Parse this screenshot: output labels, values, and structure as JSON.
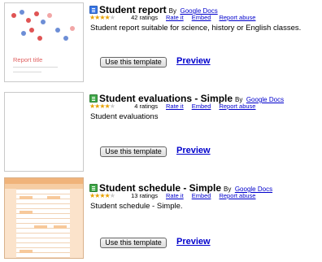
{
  "templates": [
    {
      "icon": "docs-icon",
      "title": "Student report",
      "by_label": "By",
      "author": "Google Docs",
      "rating_stars": 4,
      "ratings_label": "42 ratings",
      "rate_label": "Rate it",
      "embed_label": "Embed",
      "report_label": "Report abuse",
      "description": "Student report suitable for science, history or English classes.",
      "use_label": "Use this template",
      "preview_label": "Preview",
      "thumbnail": {
        "title": "Report title"
      }
    },
    {
      "icon": "sheets-icon",
      "title": "Student evaluations - Simple",
      "by_label": "By",
      "author": "Google Docs",
      "rating_stars": 4,
      "ratings_label": "4 ratings",
      "rate_label": "Rate it",
      "embed_label": "Embed",
      "report_label": "Report abuse",
      "description": "Student evaluations",
      "use_label": "Use this template",
      "preview_label": "Preview"
    },
    {
      "icon": "sheets-icon",
      "title": "Student schedule - Simple",
      "by_label": "By",
      "author": "Google Docs",
      "rating_stars": 4,
      "ratings_label": "13 ratings",
      "rate_label": "Rate it",
      "embed_label": "Embed",
      "report_label": "Report abuse",
      "description": "Student schedule - Simple.",
      "use_label": "Use this template",
      "preview_label": "Preview"
    }
  ],
  "colors": {
    "link": "#0000cc",
    "star": "#e8a100",
    "docs_icon": "#3b78e7",
    "sheets_icon": "#40a849"
  }
}
